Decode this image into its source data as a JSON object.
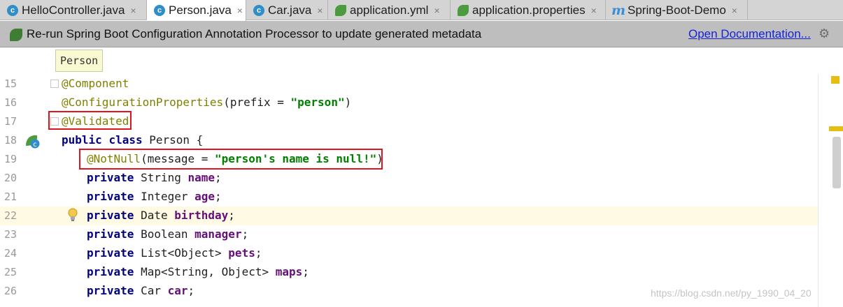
{
  "tabs": [
    {
      "label": "HelloController.java",
      "icon": "class-icon"
    },
    {
      "label": "Person.java",
      "icon": "class-icon",
      "active": true
    },
    {
      "label": "Car.java",
      "icon": "class-icon"
    },
    {
      "label": "application.yml",
      "icon": "spring-config-icon"
    },
    {
      "label": "application.properties",
      "icon": "spring-config-icon"
    },
    {
      "label": "Spring-Boot-Demo",
      "icon": "module-icon"
    }
  ],
  "tab_icon_letters": {
    "class": "c",
    "module": "m"
  },
  "tab_close_glyph": "×",
  "banner": {
    "message": "Re-run Spring Boot Configuration Annotation Processor to update generated metadata",
    "link": "Open Documentation..."
  },
  "breadcrumb": "Person",
  "line_numbers": [
    "15",
    "16",
    "17",
    "18",
    "19",
    "20",
    "21",
    "22",
    "23",
    "24",
    "25",
    "26"
  ],
  "code": {
    "l15": {
      "ann": "@Component"
    },
    "l16": {
      "ann": "@ConfigurationProperties",
      "p1": "(prefix = ",
      "str": "\"person\"",
      "p2": ")"
    },
    "l17": {
      "ann": "@Validated"
    },
    "l18": {
      "kw1": "public",
      "sp": " ",
      "kw2": "class",
      "rest": " Person {"
    },
    "l19": {
      "ann": "@NotNull",
      "p1": "(message = ",
      "str": "\"person's name is null!\"",
      "p2": ")"
    },
    "l20": {
      "kw": "private",
      "type": " String ",
      "fld": "name",
      "end": ";"
    },
    "l21": {
      "kw": "private",
      "type": " Integer ",
      "fld": "age",
      "end": ";"
    },
    "l22": {
      "kw": "private",
      "type": " Date ",
      "fld": "birthday",
      "end": ";"
    },
    "l23": {
      "kw": "private",
      "type": " Boolean ",
      "fld": "manager",
      "end": ";"
    },
    "l24": {
      "kw": "private",
      "type": " List<Object> ",
      "fld": "pets",
      "end": ";"
    },
    "l25": {
      "kw": "private",
      "type": " Map<String, Object> ",
      "fld": "maps",
      "end": ";"
    },
    "l26": {
      "kw": "private",
      "type": " Car ",
      "fld": "car",
      "end": ";"
    }
  },
  "gutter_class_letter": "c",
  "settings_glyph": "⚙",
  "watermark": "https://blog.csdn.net/py_1990_04_20",
  "colors": {
    "highlight_box": "#e0141e",
    "current_line": "#fffae3",
    "annotation": "#808000",
    "keyword": "#000080",
    "string": "#008000",
    "field": "#660e7a"
  }
}
